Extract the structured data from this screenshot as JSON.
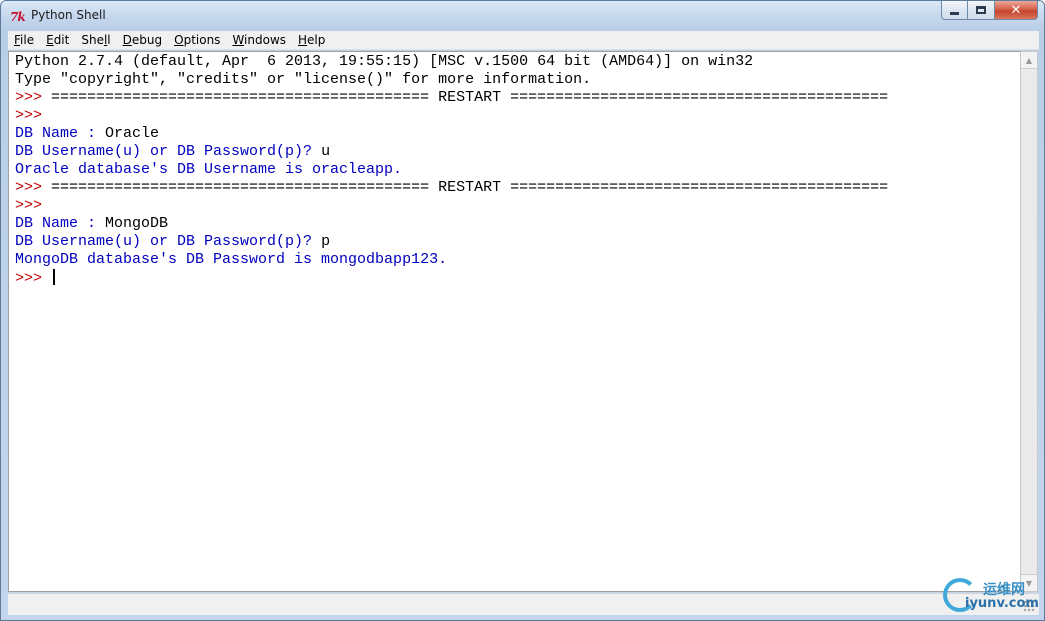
{
  "window": {
    "title": "Python Shell",
    "icon": "tk-feather-icon"
  },
  "menubar": {
    "items": [
      {
        "label": "File",
        "mnemonic": "F",
        "rest": "ile"
      },
      {
        "label": "Edit",
        "mnemonic": "E",
        "rest": "dit"
      },
      {
        "label": "Shell",
        "pre": "She",
        "mnemonic": "l",
        "rest": "l"
      },
      {
        "label": "Debug",
        "mnemonic": "D",
        "rest": "ebug"
      },
      {
        "label": "Options",
        "mnemonic": "O",
        "rest": "ptions"
      },
      {
        "label": "Windows",
        "mnemonic": "W",
        "rest": "indows"
      },
      {
        "label": "Help",
        "mnemonic": "H",
        "rest": "elp"
      }
    ]
  },
  "shell": {
    "lines": [
      [
        {
          "text": "Python 2.7.4 (default, Apr  6 2013, 19:55:15) [MSC v.1500 64 bit (AMD64)] on win32",
          "color": "black"
        }
      ],
      [
        {
          "text": "Type \"copyright\", \"credits\" or \"license()\" for more information.",
          "color": "black"
        }
      ],
      [
        {
          "text": ">>> ",
          "color": "prompt"
        },
        {
          "text": "========================================== RESTART ==========================================",
          "color": "black"
        }
      ],
      [
        {
          "text": ">>>",
          "color": "prompt"
        }
      ],
      [
        {
          "text": "DB Name : ",
          "color": "blue"
        },
        {
          "text": "Oracle",
          "color": "black"
        }
      ],
      [
        {
          "text": "DB Username(u) or DB Password(p)? ",
          "color": "blue"
        },
        {
          "text": "u",
          "color": "black"
        }
      ],
      [
        {
          "text": "Oracle database's DB Username is oracleapp.",
          "color": "blue"
        }
      ],
      [
        {
          "text": ">>> ",
          "color": "prompt"
        },
        {
          "text": "========================================== RESTART ==========================================",
          "color": "black"
        }
      ],
      [
        {
          "text": ">>>",
          "color": "prompt"
        }
      ],
      [
        {
          "text": "DB Name : ",
          "color": "blue"
        },
        {
          "text": "MongoDB",
          "color": "black"
        }
      ],
      [
        {
          "text": "DB Username(u) or DB Password(p)? ",
          "color": "blue"
        },
        {
          "text": "p",
          "color": "black"
        }
      ],
      [
        {
          "text": "MongoDB database's DB Password is mongodbapp123.",
          "color": "blue"
        }
      ],
      [
        {
          "text": ">>> ",
          "color": "prompt"
        }
      ]
    ]
  },
  "watermark": {
    "cn": "运维网",
    "en": "iyunv.com"
  },
  "colors": {
    "prompt": "#c00000",
    "output": "#0000c0",
    "input": "#000000"
  }
}
